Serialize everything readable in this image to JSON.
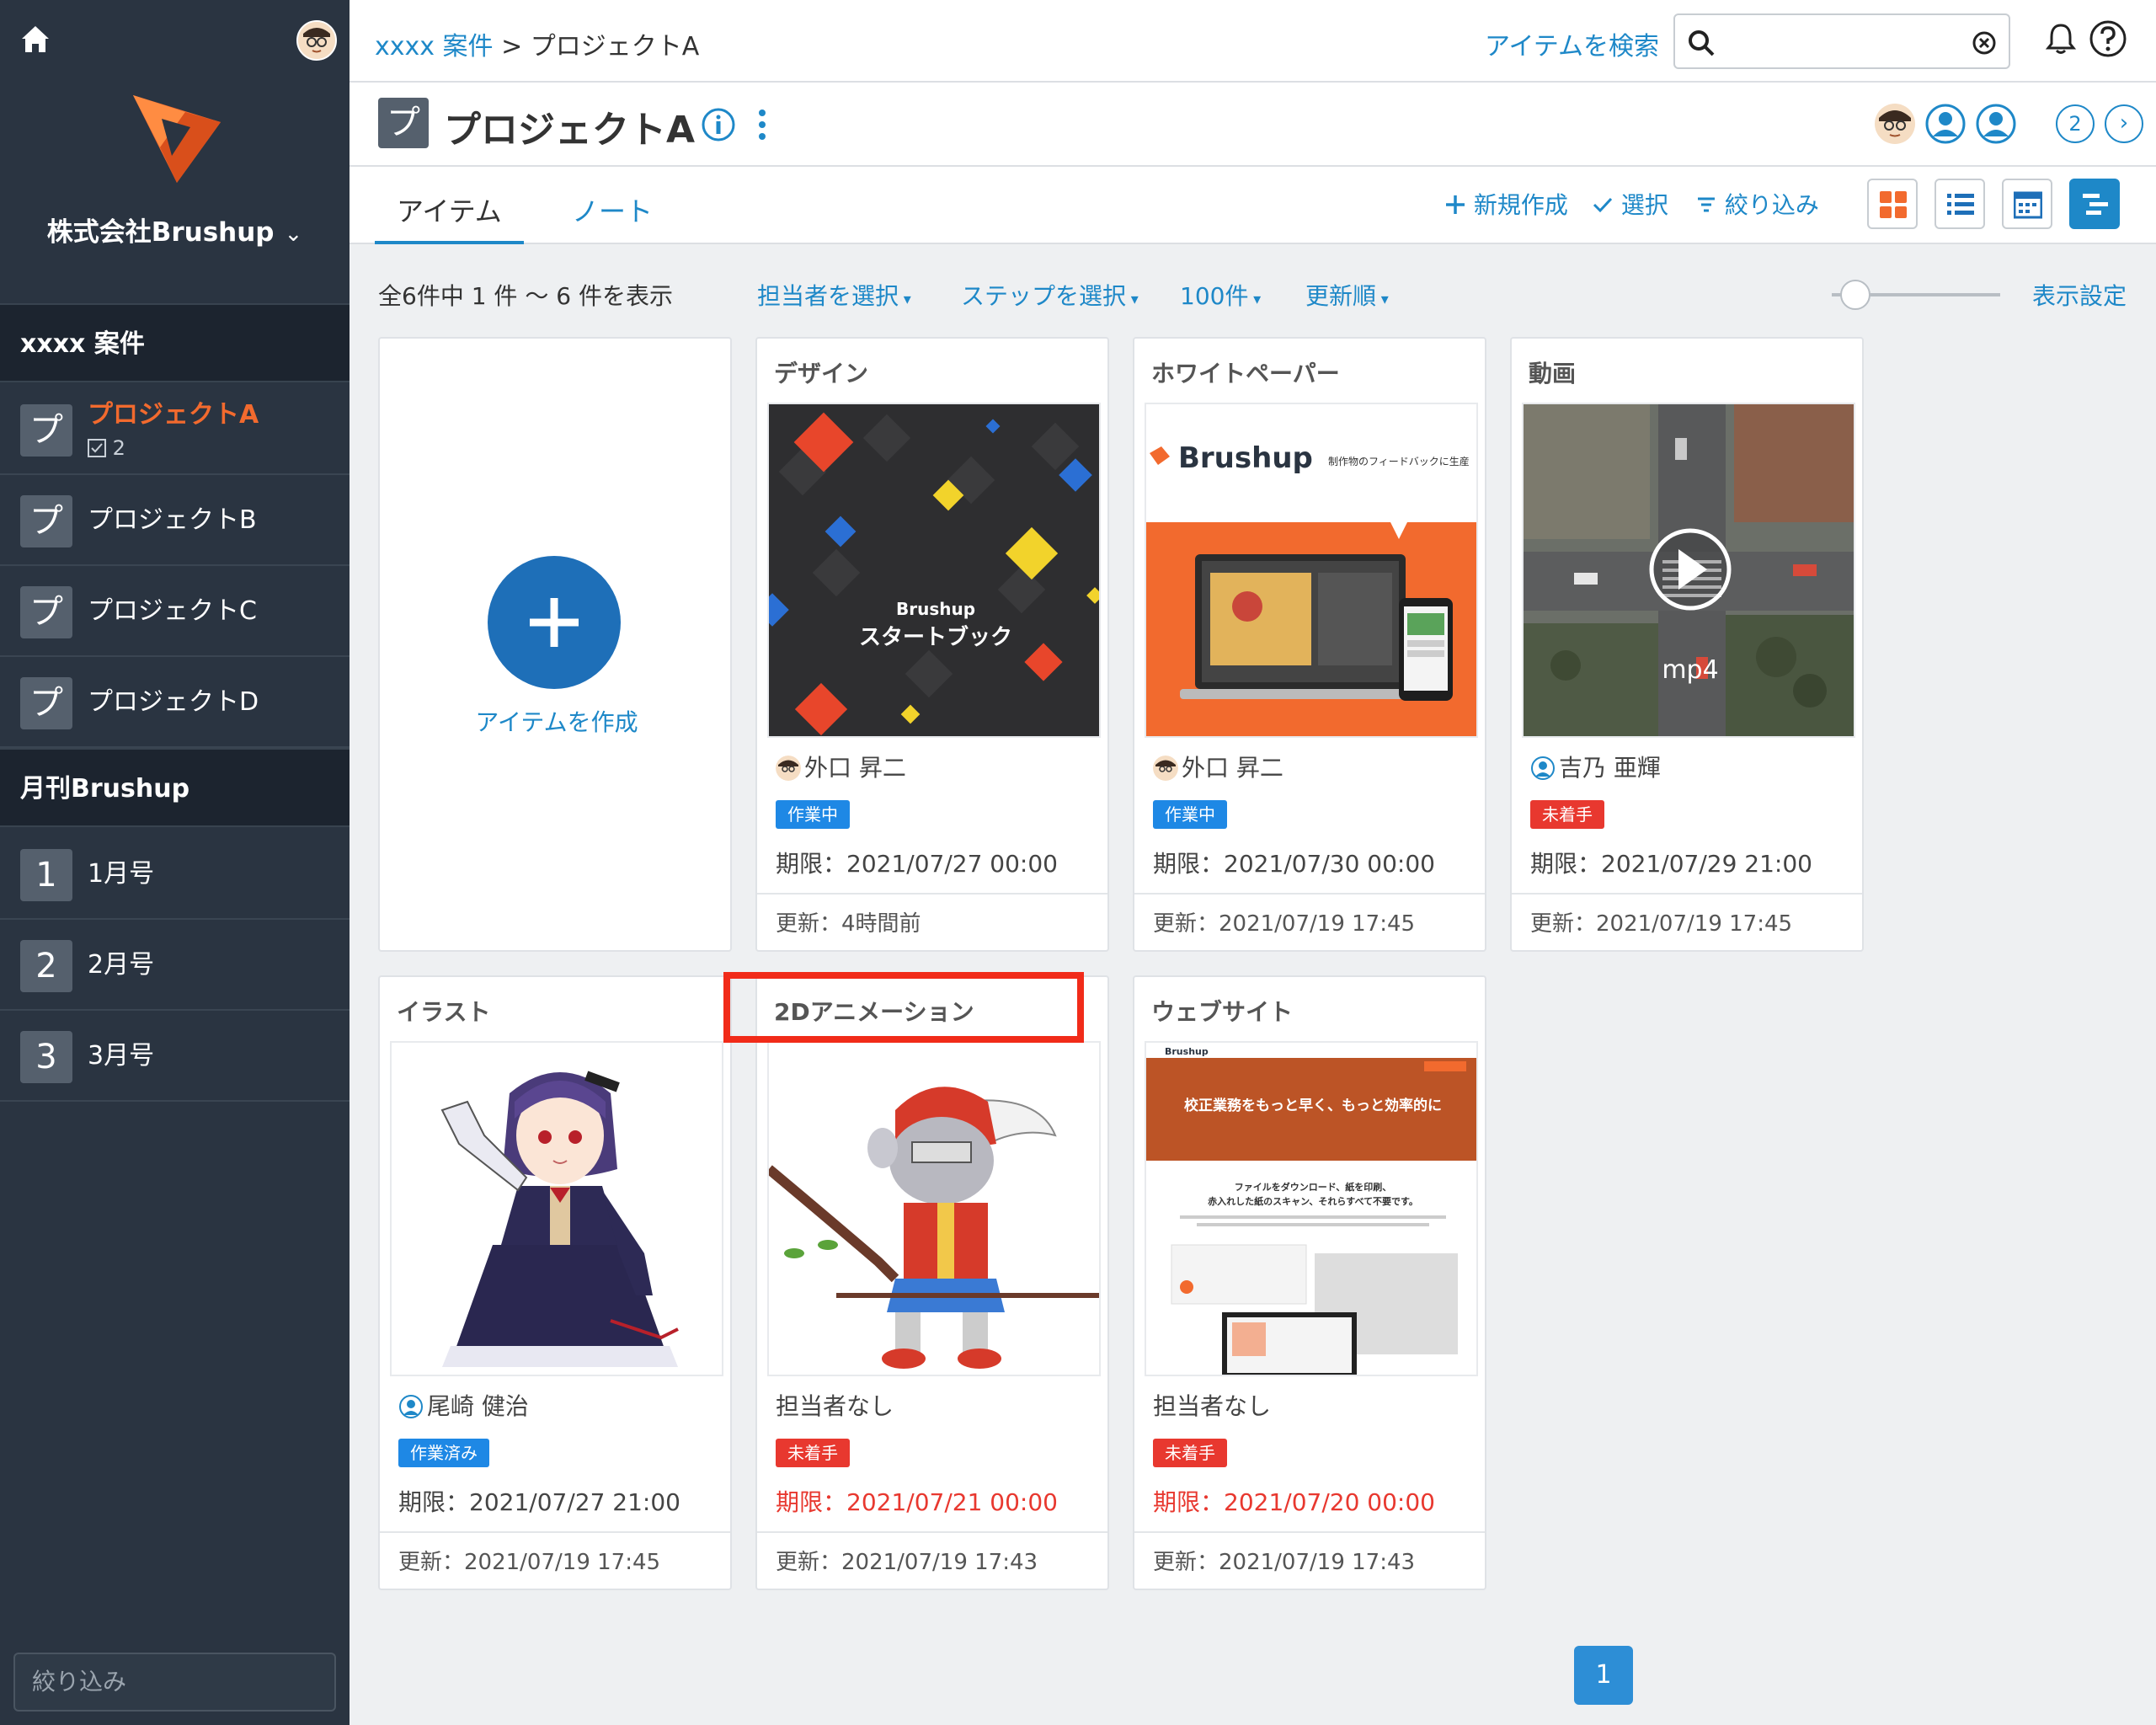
{
  "sidebar": {
    "company": "株式会社Brushup",
    "sections": [
      {
        "title": "xxxx 案件",
        "items": [
          {
            "badge": "プ",
            "label": "プロジェクトA",
            "sub": "2",
            "active": true
          },
          {
            "badge": "プ",
            "label": "プロジェクトB"
          },
          {
            "badge": "プ",
            "label": "プロジェクトC"
          },
          {
            "badge": "プ",
            "label": "プロジェクトD"
          }
        ]
      },
      {
        "title": "月刊Brushup",
        "items": [
          {
            "badge": "1",
            "label": "1月号"
          },
          {
            "badge": "2",
            "label": "2月号"
          },
          {
            "badge": "3",
            "label": "3月号"
          }
        ]
      }
    ],
    "filter_placeholder": "絞り込み"
  },
  "topbar": {
    "breadcrumb_link": "xxxx 案件",
    "breadcrumb_sep": ">",
    "breadcrumb_current": "プロジェクトA",
    "search_link": "アイテムを検索",
    "search_value": ""
  },
  "project": {
    "badge": "プ",
    "title": "プロジェクトA",
    "member_count": "2"
  },
  "tabs": {
    "items": "アイテム",
    "notes": "ノート"
  },
  "tools": {
    "new": "新規作成",
    "select": "選択",
    "filter": "絞り込み"
  },
  "filterbar": {
    "count": "全6件中 1 件 〜 6 件を表示",
    "assignee": "担当者を選択",
    "step": "ステップを選択",
    "per_page": "100件",
    "sort": "更新順",
    "display_settings": "表示設定"
  },
  "create_card": {
    "label": "アイテムを作成"
  },
  "cards": [
    {
      "title": "デザイン",
      "assignee": "外口 昇二",
      "status": "作業中",
      "status_color": "#1e88e5",
      "due": "期限：2021/07/27 00:00",
      "due_late": false,
      "updated": "更新：4時間前",
      "thumb_text": "スタートブック",
      "thumb_brand": "Brushup"
    },
    {
      "title": "ホワイトペーパー",
      "assignee": "外口 昇二",
      "status": "作業中",
      "status_color": "#1e88e5",
      "due": "期限：2021/07/30 00:00",
      "due_late": false,
      "updated": "更新：2021/07/19 17:45",
      "thumb_brand": "Brushup",
      "thumb_tagline": "制作物のフィードバックに生産"
    },
    {
      "title": "動画",
      "assignee": "吉乃 亜輝",
      "status": "未着手",
      "status_color": "#e8382f",
      "due": "期限：2021/07/29 21:00",
      "due_late": false,
      "updated": "更新：2021/07/19 17:45",
      "thumb_text": "mp4"
    },
    {
      "title": "イラスト",
      "assignee": "尾崎 健治",
      "status": "作業済み",
      "status_color": "#1e88e5",
      "due": "期限：2021/07/27 21:00",
      "due_late": false,
      "updated": "更新：2021/07/19 17:45"
    },
    {
      "title": "2Dアニメーション",
      "assignee": "担当者なし",
      "status": "未着手",
      "status_color": "#e8382f",
      "due": "期限：2021/07/21 00:00",
      "due_late": true,
      "updated": "更新：2021/07/19 17:43"
    },
    {
      "title": "ウェブサイト",
      "assignee": "担当者なし",
      "status": "未着手",
      "status_color": "#e8382f",
      "due": "期限：2021/07/20 00:00",
      "due_late": true,
      "updated": "更新：2021/07/19 17:43",
      "thumb_brand": "Brushup",
      "thumb_headline": "校正業務をもっと早く、もっと効率的に",
      "thumb_body1": "ファイルをダウンロード、紙を印刷、",
      "thumb_body2": "赤入れした紙のスキャン、それらすべて不要です。"
    }
  ],
  "pager": {
    "current": "1"
  },
  "colors": {
    "accent": "#1e88c8",
    "sidebar_bg": "#2a3441",
    "active_project": "#f26a2e",
    "status_in_progress": "#1e88e5",
    "status_not_started": "#e8382f",
    "highlight": "#f12b19"
  }
}
